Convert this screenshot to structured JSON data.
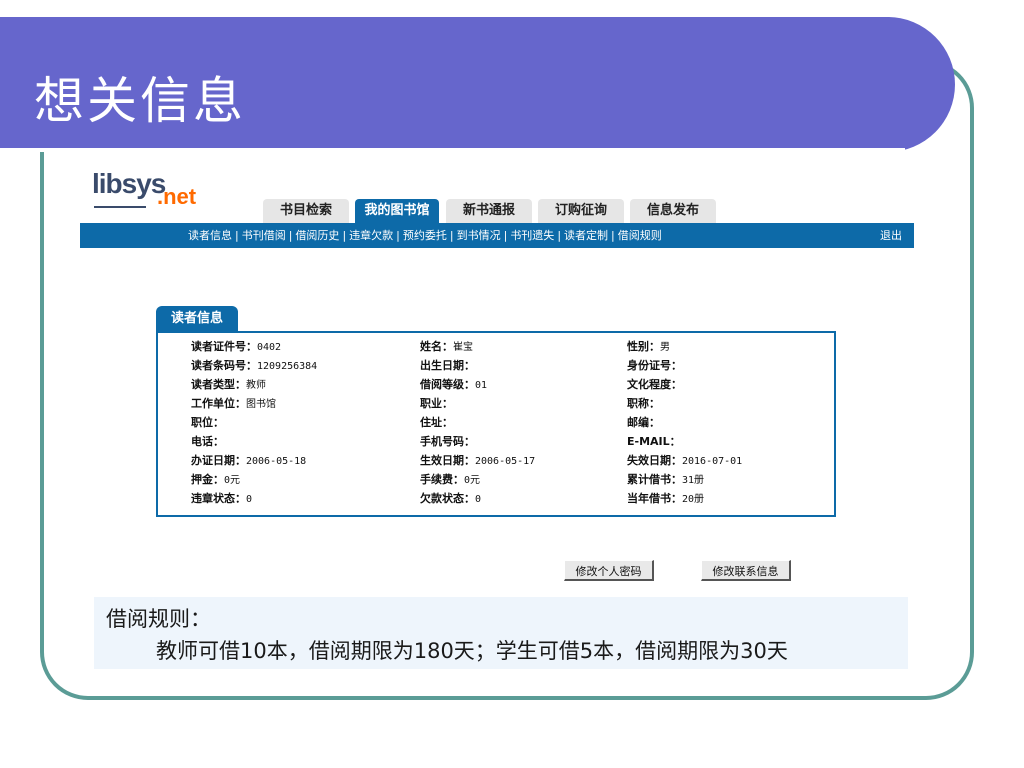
{
  "slide": {
    "title": "想关信息"
  },
  "app": {
    "logo": {
      "brand": "libsys",
      "suffix": ".net"
    },
    "tabs": [
      {
        "label": "书目检索",
        "active": false
      },
      {
        "label": "我的图书馆",
        "active": true
      },
      {
        "label": "新书通报",
        "active": false
      },
      {
        "label": "订购征询",
        "active": false
      },
      {
        "label": "信息发布",
        "active": false
      }
    ],
    "subnav": [
      "读者信息",
      "书刊借阅",
      "借阅历史",
      "违章欠款",
      "预约委托",
      "到书情况",
      "书刊遗失",
      "读者定制",
      "借阅规则"
    ],
    "logout": "退出",
    "panel_title": "读者信息",
    "fields": [
      [
        {
          "label": "读者证件号：",
          "value": "0402"
        },
        {
          "label": "姓名：",
          "value": "崔宝"
        },
        {
          "label": "性别：",
          "value": "男"
        }
      ],
      [
        {
          "label": "读者条码号：",
          "value": "1209256384"
        },
        {
          "label": "出生日期：",
          "value": ""
        },
        {
          "label": "身份证号：",
          "value": ""
        }
      ],
      [
        {
          "label": "读者类型：",
          "value": "教师"
        },
        {
          "label": "借阅等级：",
          "value": "01"
        },
        {
          "label": "文化程度：",
          "value": ""
        }
      ],
      [
        {
          "label": "工作单位：",
          "value": "图书馆"
        },
        {
          "label": "职业：",
          "value": ""
        },
        {
          "label": "职称：",
          "value": ""
        }
      ],
      [
        {
          "label": "职位：",
          "value": ""
        },
        {
          "label": "住址：",
          "value": ""
        },
        {
          "label": "邮编：",
          "value": ""
        }
      ],
      [
        {
          "label": "电话：",
          "value": ""
        },
        {
          "label": "手机号码：",
          "value": ""
        },
        {
          "label": "E-MAIL：",
          "value": ""
        }
      ],
      [
        {
          "label": "办证日期：",
          "value": "2006-05-18"
        },
        {
          "label": "生效日期：",
          "value": "2006-05-17"
        },
        {
          "label": "失效日期：",
          "value": "2016-07-01"
        }
      ],
      [
        {
          "label": "押金：",
          "value": "0元"
        },
        {
          "label": "手续费：",
          "value": "0元"
        },
        {
          "label": "累计借书：",
          "value": "31册"
        }
      ],
      [
        {
          "label": "违章状态：",
          "value": "0"
        },
        {
          "label": "欠款状态：",
          "value": "0"
        },
        {
          "label": "当年借书：",
          "value": "20册"
        }
      ]
    ],
    "buttons": {
      "change_password": "修改个人密码",
      "change_contact": "修改联系信息"
    }
  },
  "rules": {
    "title": "借阅规则：",
    "body": "教师可借10本，借阅期限为180天；学生可借5本，借阅期限为30天"
  }
}
